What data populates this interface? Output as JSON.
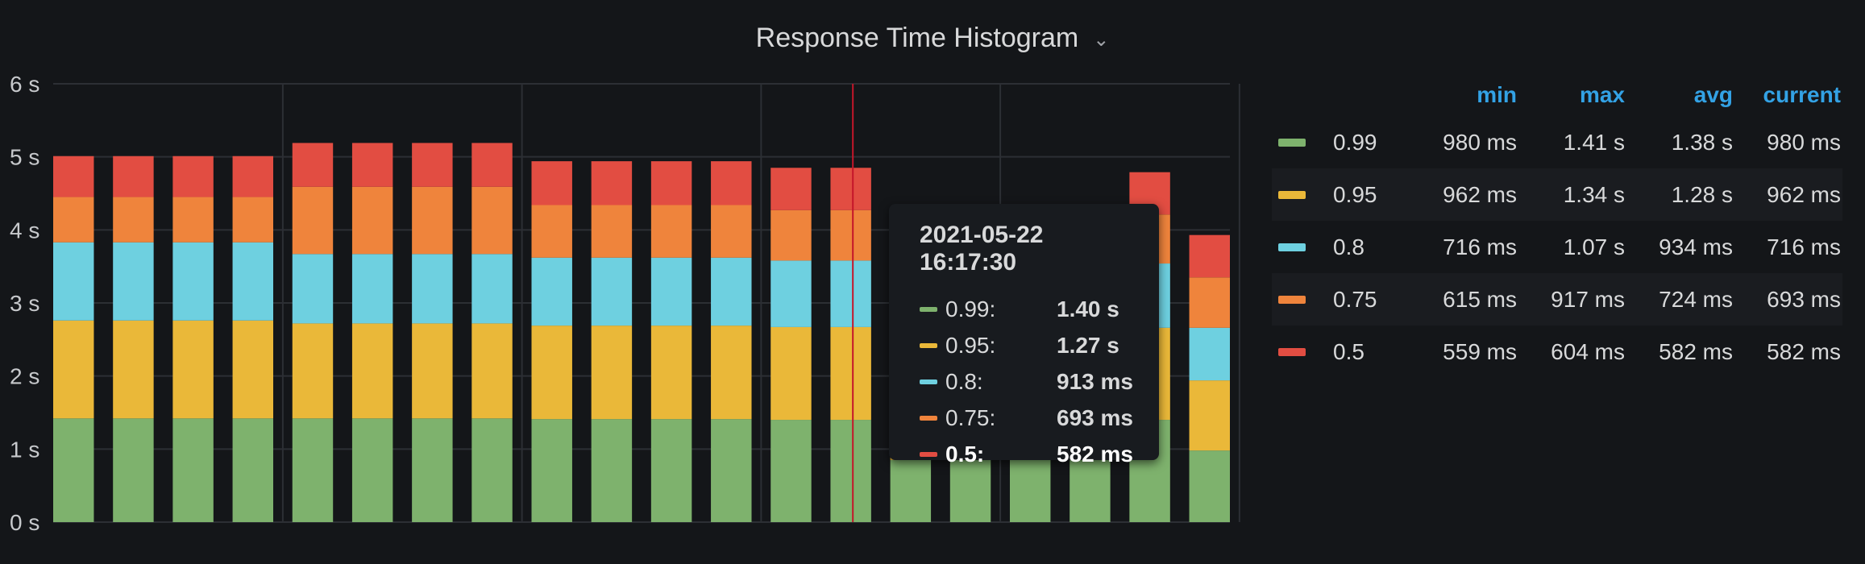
{
  "panel": {
    "title": "Response Time Histogram",
    "chevron_icon": "chevron-down-icon"
  },
  "colors": {
    "0.99": "#7eb26d",
    "0.95": "#eab839",
    "0.8": "#6ed0e0",
    "0.75": "#ef843c",
    "0.5": "#e24d42",
    "grid": "#2c2f34",
    "cursor": "#c4162a",
    "axis_text": "#c7c9cc",
    "legend_header": "#33a2e5"
  },
  "chart_data": {
    "type": "bar",
    "stacked": true,
    "title": "Response Time Histogram",
    "ylabel": "",
    "xlabel": "",
    "ylim": [
      0,
      6
    ],
    "yticks": [
      "0 s",
      "1 s",
      "2 s",
      "3 s",
      "4 s",
      "5 s",
      "6 s"
    ],
    "grid": true,
    "legend_position": "right",
    "cursor_index": 13,
    "series": [
      {
        "name": "0.99",
        "values": [
          1.42,
          1.42,
          1.42,
          1.42,
          1.42,
          1.42,
          1.42,
          1.42,
          1.41,
          1.41,
          1.41,
          1.41,
          1.4,
          1.4,
          0.85,
          0.85,
          0.85,
          0.85,
          1.4,
          0.98
        ]
      },
      {
        "name": "0.95",
        "values": [
          1.34,
          1.34,
          1.34,
          1.34,
          1.3,
          1.3,
          1.3,
          1.3,
          1.28,
          1.28,
          1.28,
          1.28,
          1.27,
          1.27,
          1.27,
          1.27,
          1.27,
          1.27,
          1.26,
          0.96
        ]
      },
      {
        "name": "0.8",
        "values": [
          1.07,
          1.07,
          1.07,
          1.07,
          0.95,
          0.95,
          0.95,
          0.95,
          0.93,
          0.93,
          0.93,
          0.93,
          0.91,
          0.91,
          0.91,
          0.91,
          0.91,
          0.91,
          0.88,
          0.72
        ]
      },
      {
        "name": "0.75",
        "values": [
          0.62,
          0.62,
          0.62,
          0.62,
          0.92,
          0.92,
          0.92,
          0.92,
          0.72,
          0.72,
          0.72,
          0.72,
          0.69,
          0.69,
          0.69,
          0.69,
          0.69,
          0.69,
          0.67,
          0.69
        ]
      },
      {
        "name": "0.5",
        "values": [
          0.56,
          0.56,
          0.56,
          0.56,
          0.6,
          0.6,
          0.6,
          0.6,
          0.6,
          0.6,
          0.6,
          0.6,
          0.58,
          0.58,
          0.58,
          0.58,
          0.58,
          0.58,
          0.58,
          0.58
        ]
      }
    ]
  },
  "legend": {
    "headers": {
      "min": "min",
      "max": "max",
      "avg": "avg",
      "current": "current"
    },
    "rows": [
      {
        "name": "0.99",
        "min": "980 ms",
        "max": "1.41 s",
        "avg": "1.38 s",
        "current": "980 ms",
        "color": "#7eb26d"
      },
      {
        "name": "0.95",
        "min": "962 ms",
        "max": "1.34 s",
        "avg": "1.28 s",
        "current": "962 ms",
        "color": "#eab839"
      },
      {
        "name": "0.8",
        "min": "716 ms",
        "max": "1.07 s",
        "avg": "934 ms",
        "current": "716 ms",
        "color": "#6ed0e0"
      },
      {
        "name": "0.75",
        "min": "615 ms",
        "max": "917 ms",
        "avg": "724 ms",
        "current": "693 ms",
        "color": "#ef843c"
      },
      {
        "name": "0.5",
        "min": "559 ms",
        "max": "604 ms",
        "avg": "582 ms",
        "current": "582 ms",
        "color": "#e24d42"
      }
    ]
  },
  "tooltip": {
    "time": "2021-05-22 16:17:30",
    "rows": [
      {
        "label": "0.99:",
        "value": "1.40 s",
        "color": "#7eb26d"
      },
      {
        "label": "0.95:",
        "value": "1.27 s",
        "color": "#eab839"
      },
      {
        "label": "0.8:",
        "value": "913 ms",
        "color": "#6ed0e0"
      },
      {
        "label": "0.75:",
        "value": "693 ms",
        "color": "#ef843c"
      },
      {
        "label": "0.5:",
        "value": "582 ms",
        "color": "#e24d42",
        "highlight": true
      }
    ]
  }
}
